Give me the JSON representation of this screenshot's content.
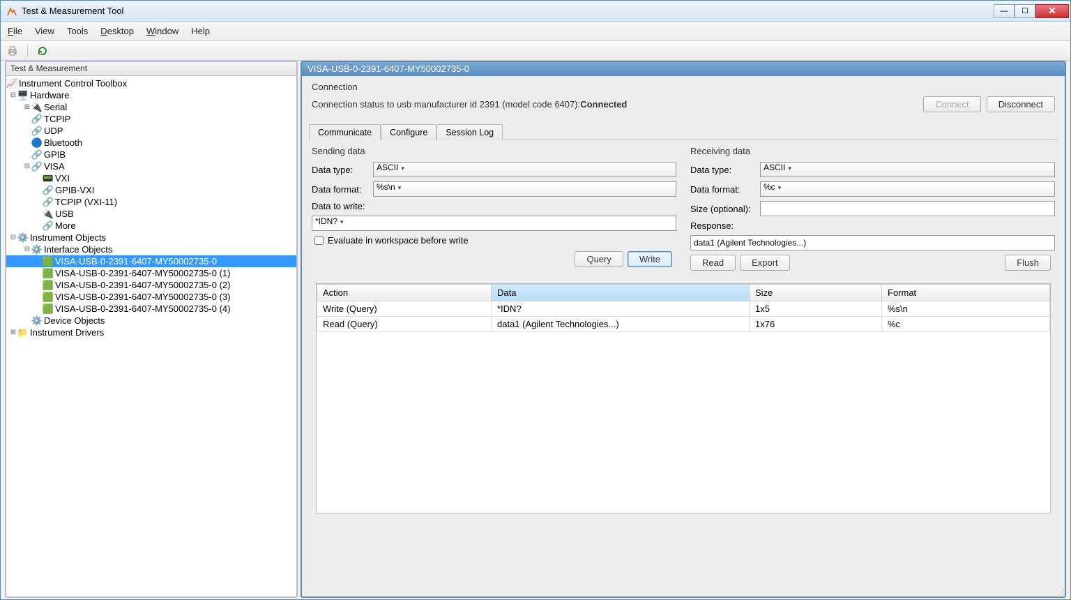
{
  "window": {
    "title": "Test & Measurement Tool"
  },
  "menu": {
    "file": "File",
    "view": "View",
    "tools": "Tools",
    "desktop": "Desktop",
    "window": "Window",
    "help": "Help"
  },
  "leftPanel": {
    "title": "Test & Measurement"
  },
  "tree": {
    "root": "Instrument Control Toolbox",
    "hardware": "Hardware",
    "serial": "Serial",
    "tcpip": "TCPIP",
    "udp": "UDP",
    "bluetooth": "Bluetooth",
    "gpib": "GPIB",
    "visa": "VISA",
    "vxi": "VXI",
    "gpibvxi": "GPIB-VXI",
    "tcpipvxi": "TCPIP (VXI-11)",
    "usb": "USB",
    "more": "More",
    "instrObjects": "Instrument Objects",
    "ifaceObjects": "Interface Objects",
    "v0": "VISA-USB-0-2391-6407-MY50002735-0",
    "v1": "VISA-USB-0-2391-6407-MY50002735-0 (1)",
    "v2": "VISA-USB-0-2391-6407-MY50002735-0 (2)",
    "v3": "VISA-USB-0-2391-6407-MY50002735-0 (3)",
    "v4": "VISA-USB-0-2391-6407-MY50002735-0 (4)",
    "deviceObjects": "Device Objects",
    "instrDrivers": "Instrument Drivers"
  },
  "right": {
    "title": "VISA-USB-0-2391-6407-MY50002735-0",
    "connSection": "Connection",
    "connStatusPrefix": "Connection status to usb manufacturer id 2391 (model code 6407): ",
    "connStatus": "Connected",
    "btnConnect": "Connect",
    "btnDisconnect": "Disconnect",
    "tabs": {
      "communicate": "Communicate",
      "configure": "Configure",
      "sessionLog": "Session Log"
    },
    "send": {
      "title": "Sending data",
      "dataType": "Data type:",
      "dataTypeVal": "ASCII",
      "dataFormat": "Data format:",
      "dataFormatVal": "%s\\n",
      "dataToWrite": "Data to write:",
      "dataToWriteVal": "*IDN?",
      "evalCheckbox": "Evaluate in workspace before write",
      "btnQuery": "Query",
      "btnWrite": "Write"
    },
    "recv": {
      "title": "Receiving data",
      "dataType": "Data type:",
      "dataTypeVal": "ASCII",
      "dataFormat": "Data format:",
      "dataFormatVal": "%c",
      "size": "Size (optional):",
      "sizeVal": "",
      "response": "Response:",
      "responseVal": "data1 (Agilent Technologies...)",
      "btnRead": "Read",
      "btnExport": "Export",
      "btnFlush": "Flush"
    }
  },
  "table": {
    "cols": {
      "action": "Action",
      "data": "Data",
      "size": "Size",
      "format": "Format"
    },
    "rows": [
      {
        "action": "Write (Query)",
        "data": "*IDN?",
        "size": "1x5",
        "format": "%s\\n"
      },
      {
        "action": "Read (Query)",
        "data": "data1 (Agilent Technologies...)",
        "size": "1x76",
        "format": "%c"
      }
    ]
  }
}
